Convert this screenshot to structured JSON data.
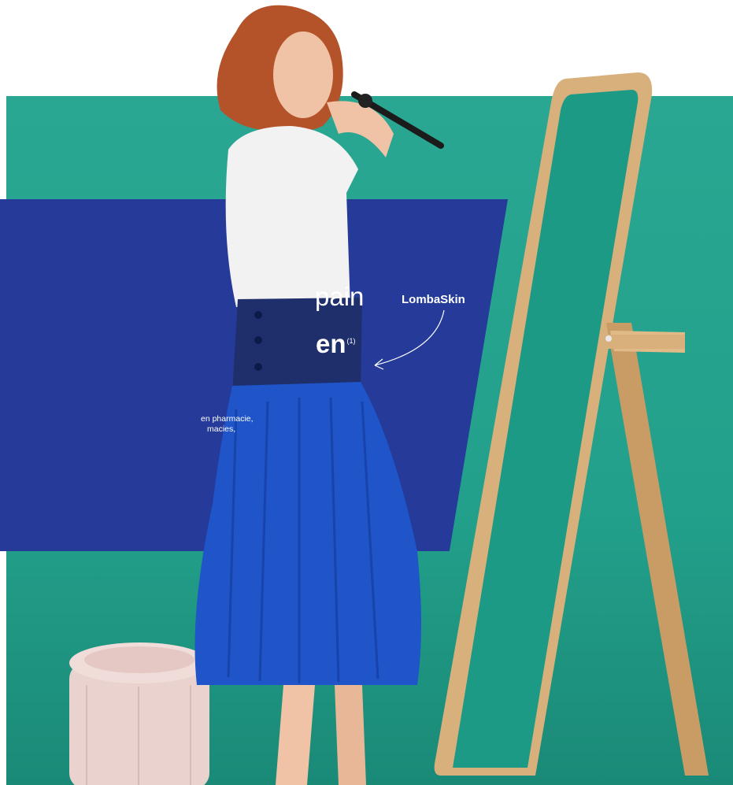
{
  "headline": {
    "line1_fragment": "pain",
    "line2_fragment": "en",
    "footnote_marker": "(1)"
  },
  "body_text": {
    "line1_fragment": "en pharmacie,",
    "line2_fragment": "macies,"
  },
  "product_label": "LombaSkin",
  "colors": {
    "teal_background": "#22a08b",
    "panel_blue": "#253a99",
    "text": "#ffffff",
    "skirt_blue": "#1f55c8",
    "brace_navy": "#1e2f6b",
    "wood": "#d8b07c",
    "pouf_pink": "#e7cbc9"
  }
}
